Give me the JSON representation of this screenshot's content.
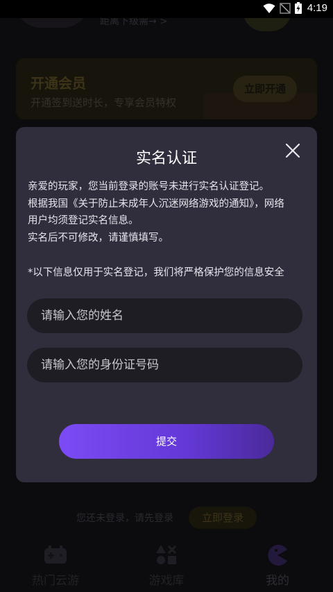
{
  "status_bar": {
    "time": "4:19"
  },
  "background": {
    "level_hint": "距离下级需→ >",
    "vip_card": {
      "title": "开通会员",
      "description": "开通签到送时长，专享会员特权",
      "button": "立即开通"
    },
    "login_prompt": {
      "text": "您还未登录，请先登录",
      "button": "立即登录"
    },
    "tabs": [
      {
        "label": "热门云游",
        "icon": "gamepad-icon"
      },
      {
        "label": "游戏库",
        "icon": "grid-shapes-icon"
      },
      {
        "label": "我的",
        "icon": "pacman-icon",
        "active": true
      }
    ]
  },
  "dialog": {
    "title": "实名认证",
    "lines": [
      "亲爱的玩家，您当前登录的账号未进行实名认证登记。",
      "根据我国《关于防止未成年人沉迷网络游戏的通知》，网络",
      "用户均须登记实名信息。",
      "实名后不可修改，请谨慎填写。"
    ],
    "notice": "*以下信息仅用于实名登记，我们将严格保护您的信息安全",
    "name_field": {
      "placeholder": "请输入您的姓名",
      "value": ""
    },
    "id_field": {
      "placeholder": "请输入您的身份证号码",
      "value": ""
    },
    "submit_label": "提交"
  },
  "colors": {
    "accent": "#7c4bf5",
    "dialog_bg": "#302e3c",
    "input_bg": "#1e1d24",
    "gold": "#6e5d2c"
  }
}
